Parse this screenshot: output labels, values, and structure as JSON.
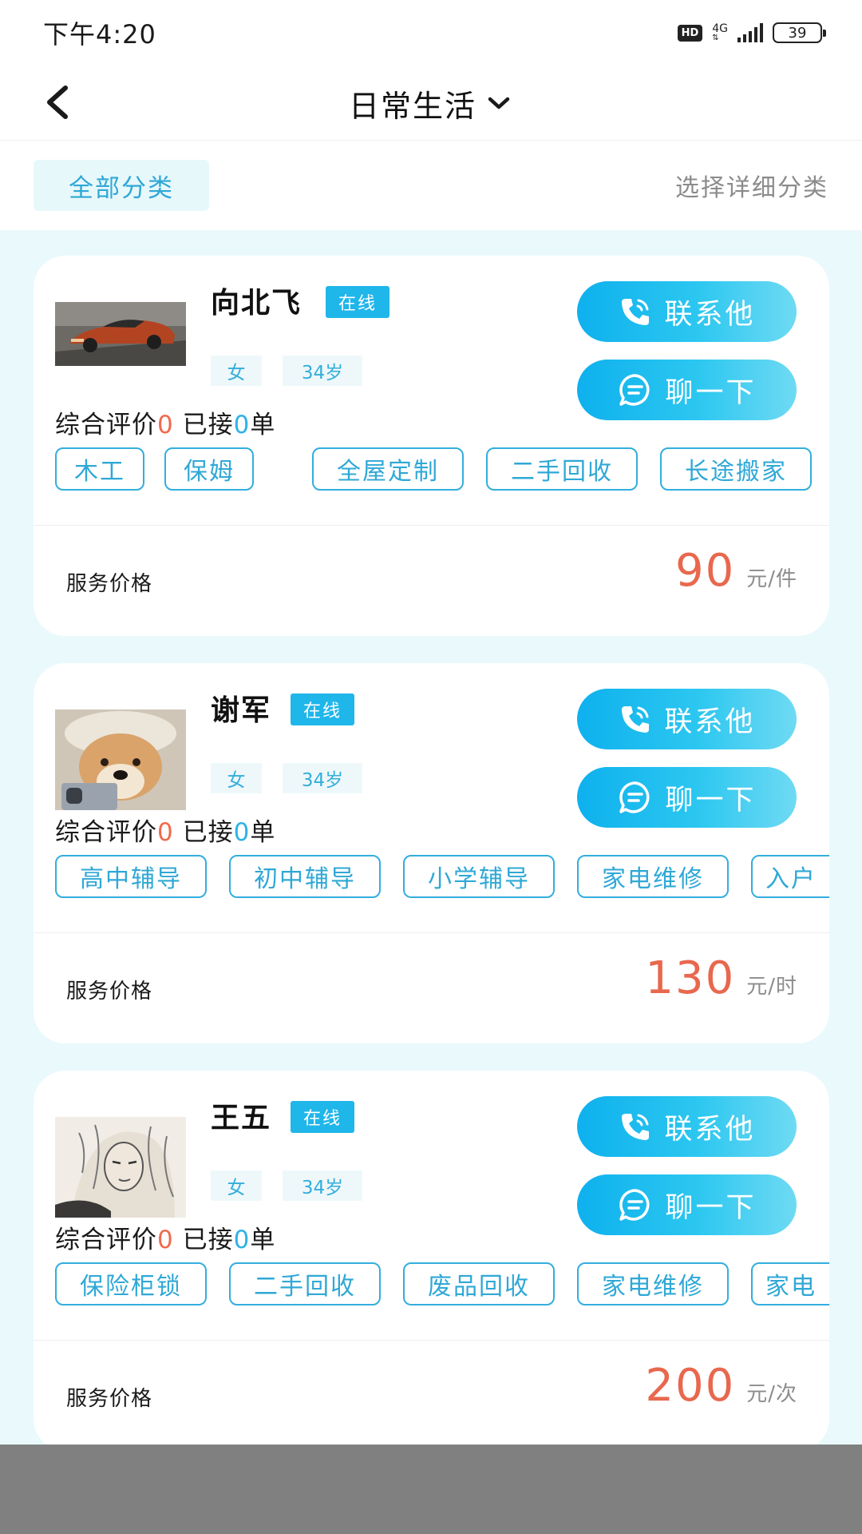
{
  "status_bar": {
    "time": "下午4:20",
    "hd": "HD",
    "network": "4G",
    "battery": "39"
  },
  "header": {
    "title": "日常生活",
    "back_icon": "chevron-left-icon",
    "dropdown_icon": "chevron-down-icon"
  },
  "filter": {
    "all_categories": "全部分类",
    "select_detail": "选择详细分类"
  },
  "colors": {
    "accent": "#1fb6ea",
    "price": "#e8684e",
    "rating_zero": "#ef6b4c",
    "list_bg": "#eaf9fb"
  },
  "providers": [
    {
      "name": "向北飞",
      "status": "在线",
      "gender": "女",
      "age": "34岁",
      "rating_label": "综合评价",
      "rating": "0",
      "orders_label": "已接",
      "orders": "0",
      "orders_suffix": "单",
      "call_label": "联系他",
      "chat_label": "聊一下",
      "tags": [
        "木工",
        "保姆",
        "全屋定制",
        "二手回收",
        "长途搬家"
      ],
      "price_label": "服务价格",
      "price": "90",
      "unit": "元/件",
      "avatar_icon": "car-photo"
    },
    {
      "name": "谢军",
      "status": "在线",
      "gender": "女",
      "age": "34岁",
      "rating_label": "综合评价",
      "rating": "0",
      "orders_label": "已接",
      "orders": "0",
      "orders_suffix": "单",
      "call_label": "联系他",
      "chat_label": "聊一下",
      "tags": [
        "高中辅导",
        "初中辅导",
        "小学辅导",
        "家电维修",
        "入户"
      ],
      "price_label": "服务价格",
      "price": "130",
      "unit": "元/时",
      "avatar_icon": "dog-photo"
    },
    {
      "name": "王五",
      "status": "在线",
      "gender": "女",
      "age": "34岁",
      "rating_label": "综合评价",
      "rating": "0",
      "orders_label": "已接",
      "orders": "0",
      "orders_suffix": "单",
      "call_label": "联系他",
      "chat_label": "聊一下",
      "tags": [
        "保险柜锁",
        "二手回收",
        "废品回收",
        "家电维修",
        "家电"
      ],
      "price_label": "服务价格",
      "price": "200",
      "unit": "元/次",
      "avatar_icon": "sketch-portrait"
    }
  ]
}
